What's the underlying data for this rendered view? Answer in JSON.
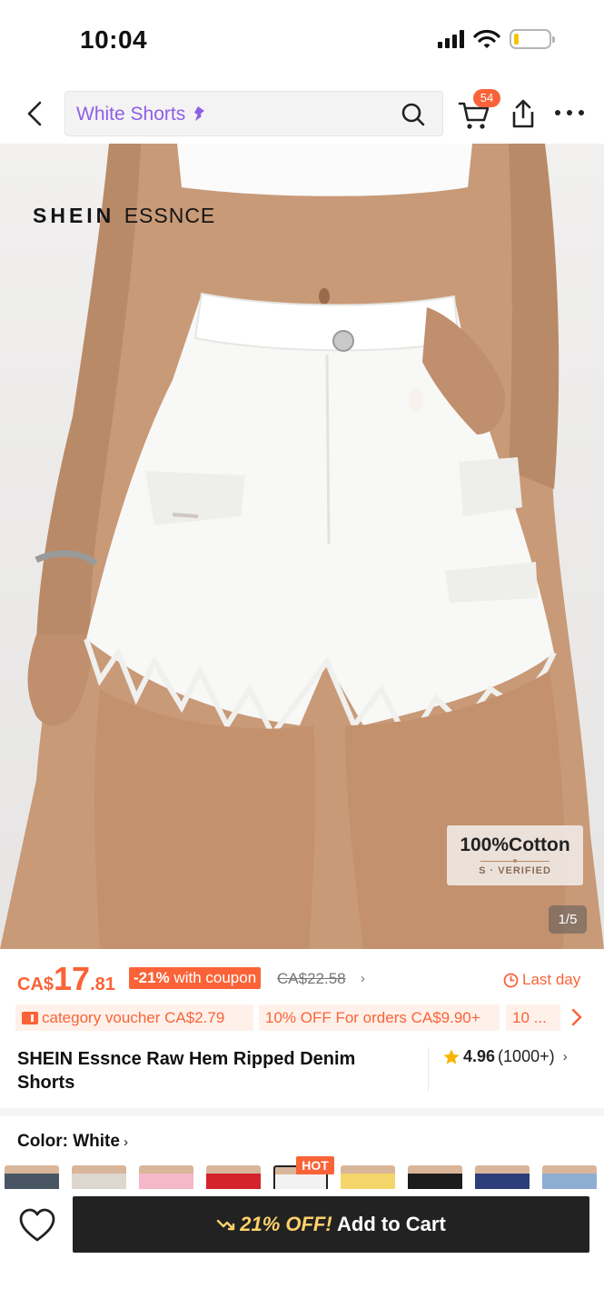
{
  "status_bar": {
    "time": "10:04"
  },
  "nav": {
    "search_text": "White Shorts",
    "cart_count": "54"
  },
  "hero": {
    "brand_bold": "SHEIN",
    "brand_light": "ESSNCE",
    "cotton_title": "100%Cotton",
    "cotton_sub": "S · VERIFIED",
    "counter": "1/5"
  },
  "price": {
    "currency": "CA$",
    "integer": "17",
    "decimal": ".81",
    "discount": "-21%",
    "coupon": "with coupon",
    "original": "CA$22.58",
    "last_day": "Last day"
  },
  "promos": [
    "category voucher CA$2.79",
    "10% OFF For orders CA$9.90+",
    "10 ..."
  ],
  "product": {
    "title": "SHEIN Essnce Raw Hem Ripped Denim Shorts",
    "rating": "4.96",
    "review_count": "(1000+)"
  },
  "color": {
    "label": "Color: White",
    "hot_badge": "HOT",
    "swatch_colors": [
      "#4a5563",
      "#ddd7cf",
      "#f4b8c8",
      "#d4232a",
      "#f2f2f2",
      "#f3d56a",
      "#1c1c1c",
      "#2d3f7a",
      "#8eaed1"
    ]
  },
  "cart_button": {
    "off_label": "21% OFF!",
    "label": "Add to Cart"
  },
  "colors": {
    "accent": "#fa6338",
    "button": "#222222",
    "search_text": "#8e5fe6"
  }
}
